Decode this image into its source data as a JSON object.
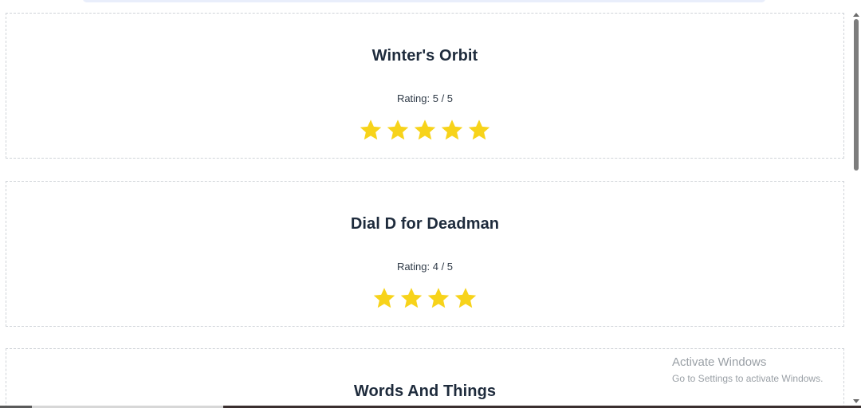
{
  "books": [
    {
      "title": "Winter's Orbit",
      "rating_label": "Rating: 5 / 5",
      "rating": 5
    },
    {
      "title": "Dial D for Deadman",
      "rating_label": "Rating: 4 / 5",
      "rating": 4
    },
    {
      "title": "Words And Things"
    }
  ],
  "watermark": {
    "title": "Activate Windows",
    "subtitle": "Go to Settings to activate Windows."
  },
  "colors": {
    "star": "#f7d31a",
    "title": "#1e2b3c"
  },
  "icons": {
    "star": "star-icon"
  }
}
